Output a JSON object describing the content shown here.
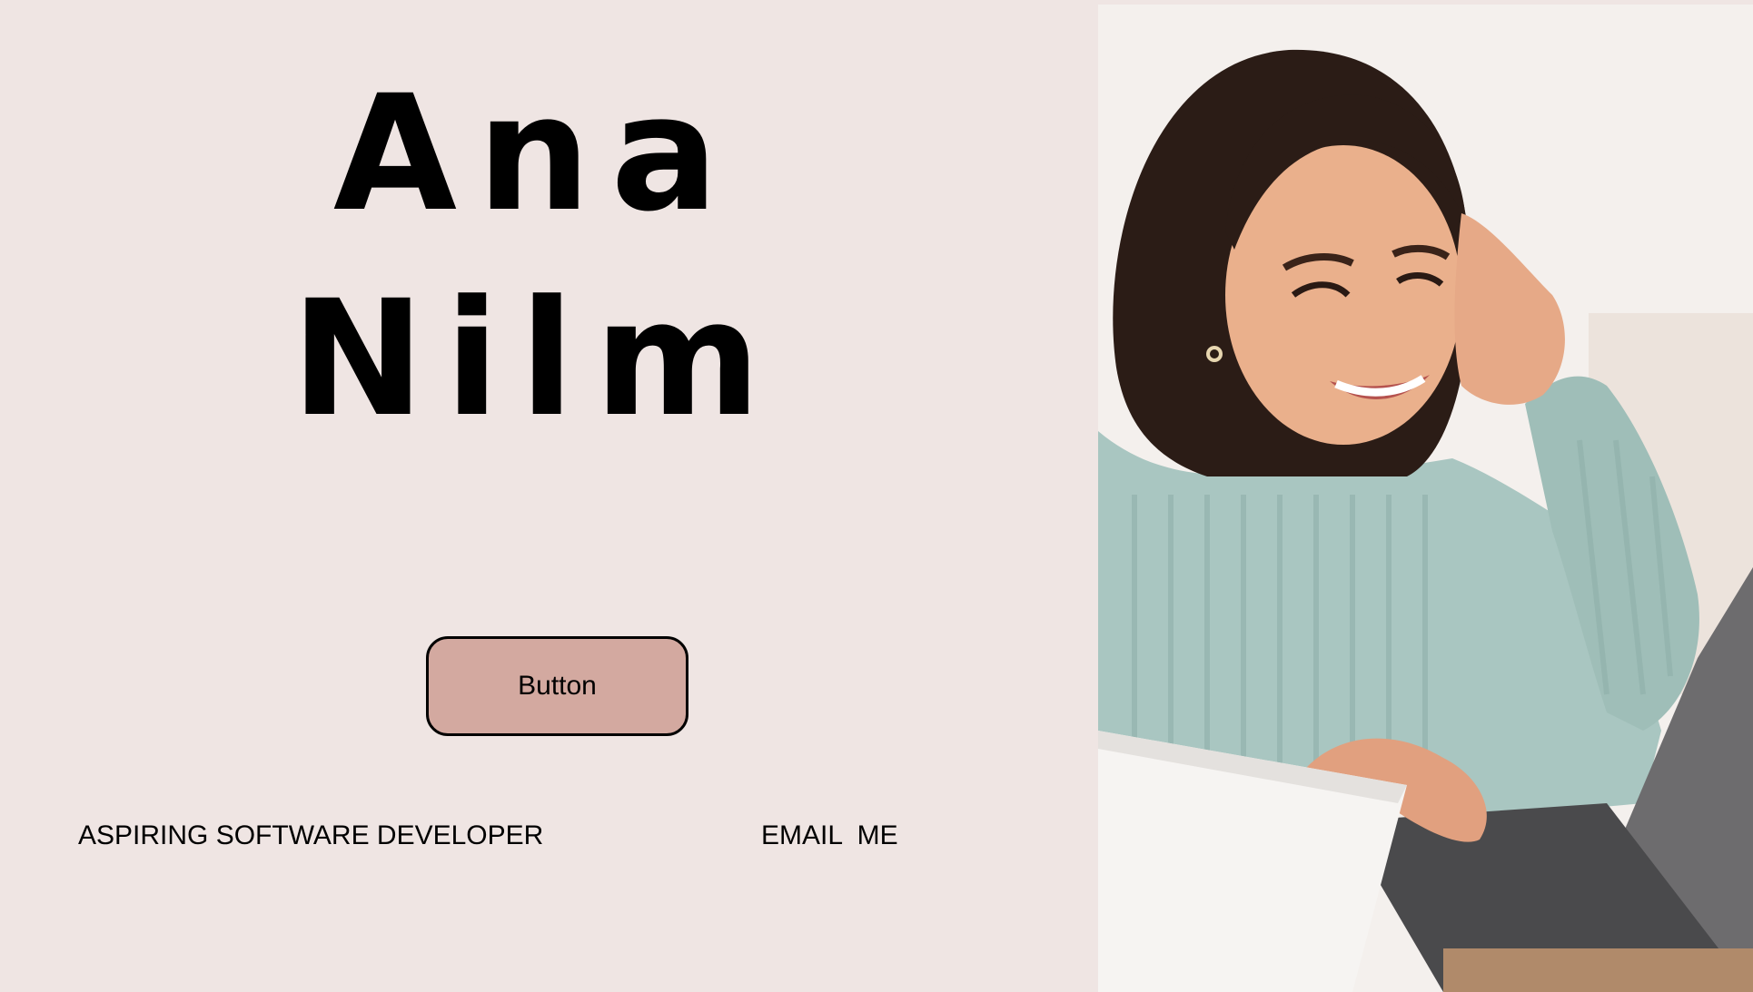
{
  "hero": {
    "first_name": "Ana",
    "last_name": "Nilm",
    "button_label": "Button",
    "tagline": "ASPIRING SOFTWARE DEVELOPER",
    "email_link": "EMAIL  ME"
  },
  "colors": {
    "background": "#efe5e3",
    "button_fill": "#d3a9a0",
    "text": "#000000"
  },
  "photo": {
    "description_icon": "portrait-photo"
  }
}
